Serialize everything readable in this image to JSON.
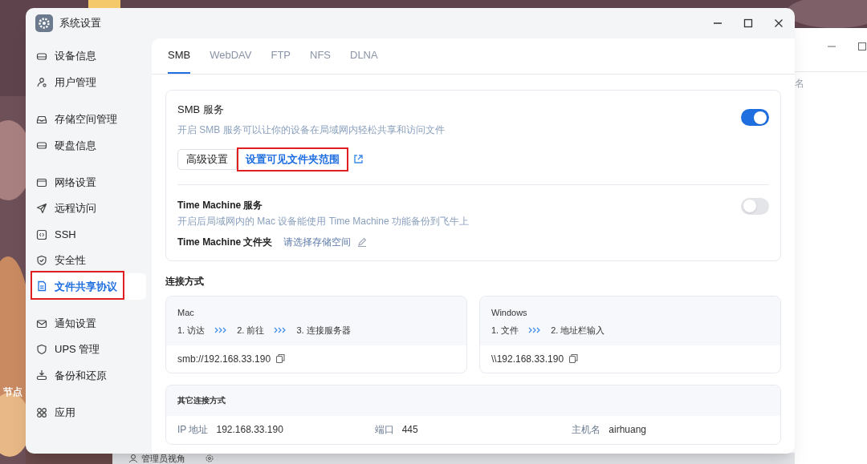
{
  "desktop": {
    "label": "节点",
    "taskbar_label": "管理员视角",
    "back_window": {
      "column_header": "名"
    }
  },
  "window": {
    "title": "系统设置"
  },
  "sidebar": {
    "groups": [
      [
        {
          "label": "设备信息",
          "selected": false
        },
        {
          "label": "用户管理",
          "selected": false
        }
      ],
      [
        {
          "label": "存储空间管理",
          "selected": false
        },
        {
          "label": "硬盘信息",
          "selected": false
        }
      ],
      [
        {
          "label": "网络设置",
          "selected": false
        },
        {
          "label": "远程访问",
          "selected": false
        },
        {
          "label": "SSH",
          "selected": false
        },
        {
          "label": "安全性",
          "selected": false
        },
        {
          "label": "文件共享协议",
          "selected": true
        }
      ],
      [
        {
          "label": "通知设置",
          "selected": false
        },
        {
          "label": "UPS 管理",
          "selected": false
        },
        {
          "label": "备份和还原",
          "selected": false
        }
      ],
      [
        {
          "label": "应用",
          "selected": false
        }
      ]
    ]
  },
  "tabs": [
    {
      "label": "SMB",
      "selected": true
    },
    {
      "label": "WebDAV",
      "selected": false
    },
    {
      "label": "FTP",
      "selected": false
    },
    {
      "label": "NFS",
      "selected": false
    },
    {
      "label": "DLNA",
      "selected": false
    }
  ],
  "smb_service": {
    "title": "SMB 服务",
    "description": "开启 SMB 服务可以让你的设备在局域网内轻松共享和访问文件",
    "on": true,
    "advanced_button": "高级设置",
    "folder_link": "设置可见文件夹范围"
  },
  "time_machine": {
    "title": "Time Machine 服务",
    "description": "开启后局域网内的 Mac 设备能使用 Time Machine 功能备份到飞牛上",
    "on": false,
    "folder_label": "Time Machine 文件夹",
    "folder_value": "请选择存储空间"
  },
  "connection": {
    "title": "连接方式",
    "methods": [
      {
        "name": "Mac",
        "steps": [
          "1. 访达",
          "2. 前往",
          "3. 连接服务器"
        ],
        "address": "smb://192.168.33.190"
      },
      {
        "name": "Windows",
        "steps": [
          "1. 文件",
          "2. 地址栏输入"
        ],
        "address": "\\\\192.168.33.190"
      }
    ],
    "other": {
      "title": "其它连接方式",
      "fields": [
        {
          "label": "IP 地址",
          "value": "192.168.33.190"
        },
        {
          "label": "端口",
          "value": "445"
        },
        {
          "label": "主机名",
          "value": "airhuang"
        }
      ]
    }
  }
}
